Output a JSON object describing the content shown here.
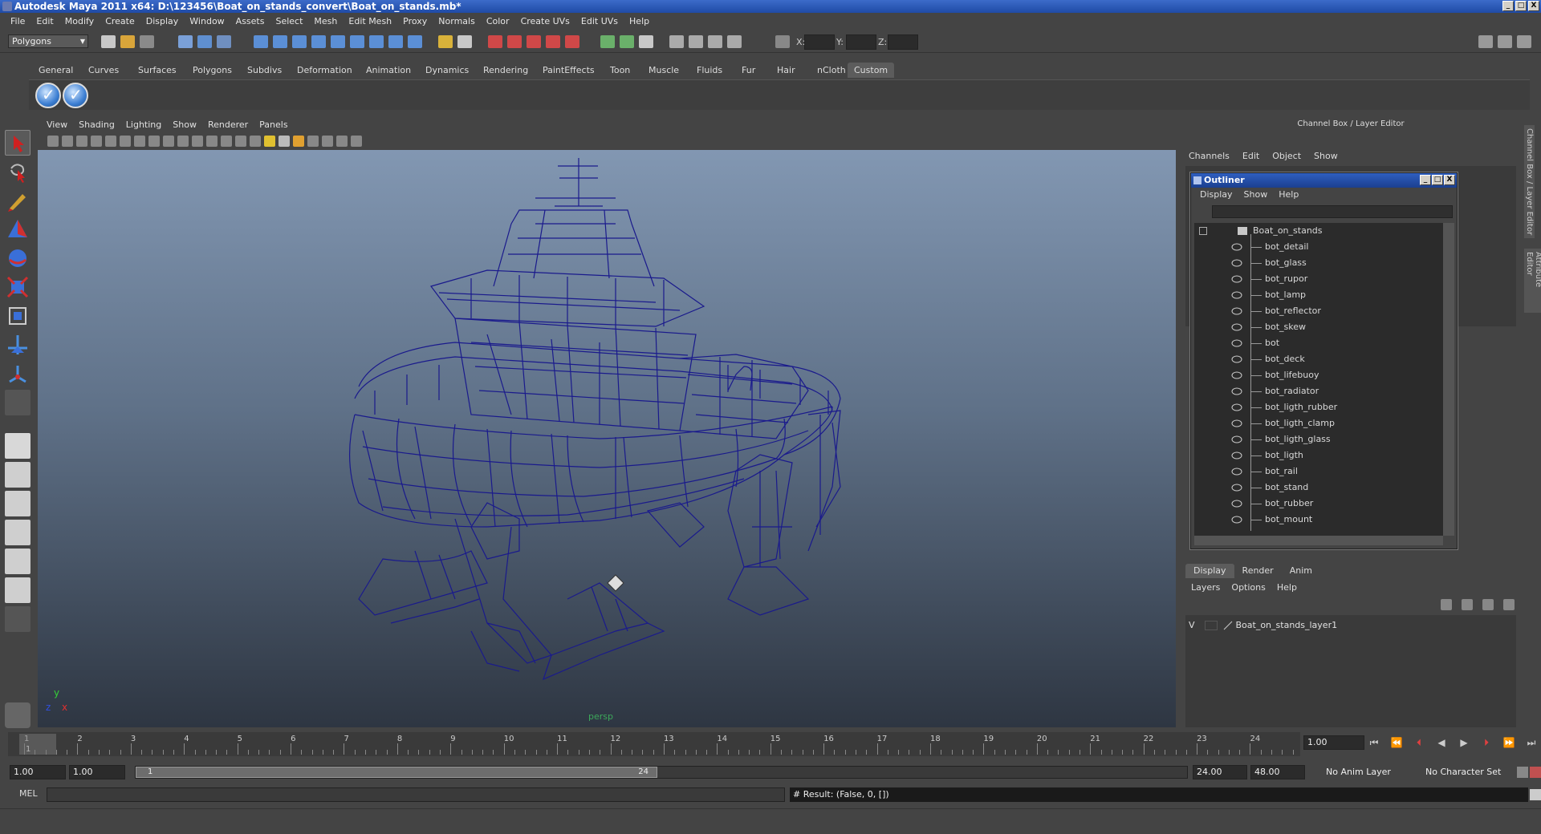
{
  "window": {
    "title": "Autodesk Maya 2011 x64: D:\\123456\\Boat_on_stands_convert\\Boat_on_stands.mb*",
    "buttons": [
      "_",
      "□",
      "X"
    ]
  },
  "menubar": [
    "File",
    "Edit",
    "Modify",
    "Create",
    "Display",
    "Window",
    "Assets",
    "Select",
    "Mesh",
    "Edit Mesh",
    "Proxy",
    "Normals",
    "Color",
    "Create UVs",
    "Edit UVs",
    "Help"
  ],
  "statusline": {
    "mode": "Polygons",
    "x_label": "X:",
    "y_label": "Y:",
    "z_label": "Z:"
  },
  "shelf": {
    "tabs": [
      "General",
      "Curves",
      "Surfaces",
      "Polygons",
      "Subdivs",
      "Deformation",
      "Animation",
      "Dynamics",
      "Rendering",
      "PaintEffects",
      "Toon",
      "Muscle",
      "Fluids",
      "Fur",
      "Hair",
      "nCloth",
      "Custom"
    ],
    "active_tab": "Custom"
  },
  "viewport": {
    "menu": [
      "View",
      "Shading",
      "Lighting",
      "Show",
      "Renderer",
      "Panels"
    ],
    "camera_label": "persp",
    "axis": {
      "x": "x",
      "y": "y",
      "z": "z"
    },
    "wire_color": "#1a1a8c"
  },
  "channel_box": {
    "title": "Channel Box / Layer Editor",
    "menu": [
      "Channels",
      "Edit",
      "Object",
      "Show"
    ]
  },
  "outliner": {
    "title": "Outliner",
    "menu": [
      "Display",
      "Show",
      "Help"
    ],
    "root": "Boat_on_stands",
    "items": [
      "bot_detail",
      "bot_glass",
      "bot_rupor",
      "bot_lamp",
      "bot_reflector",
      "bot_skew",
      "bot",
      "bot_deck",
      "bot_lifebuoy",
      "bot_radiator",
      "bot_ligth_rubber",
      "bot_ligth_clamp",
      "bot_ligth_glass",
      "bot_ligth",
      "bot_rail",
      "bot_stand",
      "bot_rubber",
      "bot_mount"
    ]
  },
  "layer_editor": {
    "tabs": [
      "Display",
      "Render",
      "Anim"
    ],
    "active_tab": "Display",
    "menu": [
      "Layers",
      "Options",
      "Help"
    ],
    "layer": {
      "visible": "V",
      "name": "Boat_on_stands_layer1"
    }
  },
  "side_tabs": [
    "Channel Box / Layer Editor",
    "Attribute Editor"
  ],
  "timeline": {
    "ticks": [
      "1",
      "2",
      "3",
      "4",
      "5",
      "6",
      "7",
      "8",
      "9",
      "10",
      "11",
      "12",
      "13",
      "14",
      "15",
      "16",
      "17",
      "18",
      "19",
      "20",
      "21",
      "22",
      "23",
      "24"
    ],
    "current_frame": "1.00",
    "current_marker": "1"
  },
  "range": {
    "start": "1.00",
    "playback_start": "1.00",
    "handle_start": "1",
    "handle_end": "24",
    "playback_end": "24.00",
    "end": "48.00",
    "anim_layer": "No Anim Layer",
    "character_set": "No Character Set"
  },
  "command": {
    "label": "MEL",
    "result": "# Result: (False, 0, [])"
  }
}
